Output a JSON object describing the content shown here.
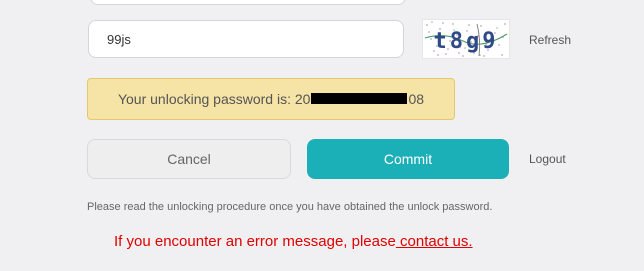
{
  "form": {
    "captcha_value": "99js",
    "refresh_label": "Refresh",
    "captcha_image_text": "t8g9"
  },
  "banner": {
    "prefix": "Your unlocking password is: 20",
    "suffix": "08"
  },
  "buttons": {
    "cancel_label": "Cancel",
    "commit_label": "Commit",
    "logout_label": "Logout"
  },
  "notice": "Please read the unlocking procedure once you have obtained the unlock password.",
  "error": {
    "prefix": "If you encounter an error message, please",
    "link_text": " contact us."
  },
  "colors": {
    "accent": "#1bb0b8",
    "banner_background": "#f6e3a6",
    "error": "#e00000"
  }
}
